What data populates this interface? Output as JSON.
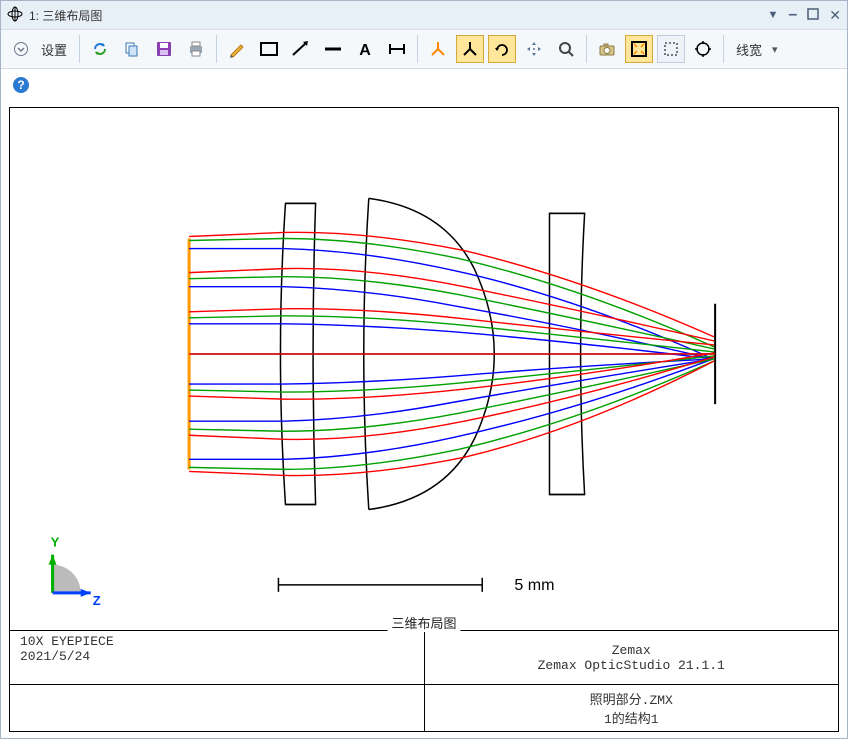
{
  "window": {
    "title_prefix": "1: ",
    "title": "三维布局图"
  },
  "toolbar": {
    "settings_label": "设置",
    "line_width_label": "线宽"
  },
  "plot": {
    "caption": "三维布局图",
    "scale_label": "5 mm",
    "axes": {
      "y": "Y",
      "z": "Z"
    }
  },
  "footer": {
    "left_line1": "10X EYEPIECE",
    "left_line2": "2021/5/24",
    "right_line1": "Zemax",
    "right_line2": "Zemax OpticStudio 21.1.1",
    "file_label": "照明部分.ZMX",
    "config_label": "1的结构1"
  },
  "colors": {
    "ray_red": "#ff0000",
    "ray_green": "#00a000",
    "ray_blue": "#0000ff",
    "accent_orange": "#ff9900",
    "optics_stroke": "#000000"
  }
}
